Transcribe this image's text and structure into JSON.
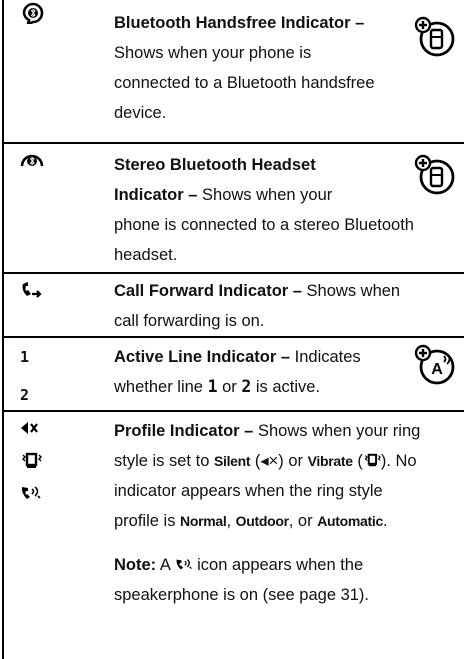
{
  "rows": [
    {
      "icon": "bluetooth-handsfree-icon",
      "title": "Bluetooth Handsfree Indicator –",
      "lines": [
        "Shows when your phone is",
        "connected to a Bluetooth handsfree",
        "device."
      ]
    },
    {
      "icon": "stereo-bluetooth-icon",
      "title_line1": "Stereo Bluetooth Headset",
      "title_line2": "Indicator –",
      "line2_rest": " Shows when your",
      "lines": [
        "phone is connected to a stereo Bluetooth",
        "headset."
      ]
    },
    {
      "icon": "call-forward-icon",
      "title": "Call Forward Indicator –",
      "rest": " Shows when",
      "lines": [
        "call forwarding is on."
      ]
    },
    {
      "icon_values": [
        "1",
        "2"
      ],
      "title": "Active Line Indicator –",
      "rest": " Indicates",
      "line2_a": "whether line ",
      "line2_b": "1",
      "line2_c": " or ",
      "line2_d": "2",
      "line2_e": " is active."
    },
    {
      "icons": [
        "silent-icon",
        "vibrate-icon",
        "speakerphone-icon"
      ],
      "title": "Profile Indicator –",
      "rest": " Shows when your ring",
      "l2a": "style is set to ",
      "silent": "Silent",
      "l2b": " (◂×) or ",
      "vibrate": "Vibrate",
      "l2c": " (",
      "l2d": "). No",
      "l3": "indicator appears when the ring style",
      "l4a": "profile is ",
      "normal": "Normal",
      "l4b": ", ",
      "outdoor": "Outdoor",
      "l4c": ", or ",
      "automatic": "Automatic",
      "l4d": ".",
      "note_label": "Note:",
      "note_a": " A ",
      "note_b": " icon appears when the",
      "note_line2": "speakerphone is on (see page 31)."
    }
  ]
}
